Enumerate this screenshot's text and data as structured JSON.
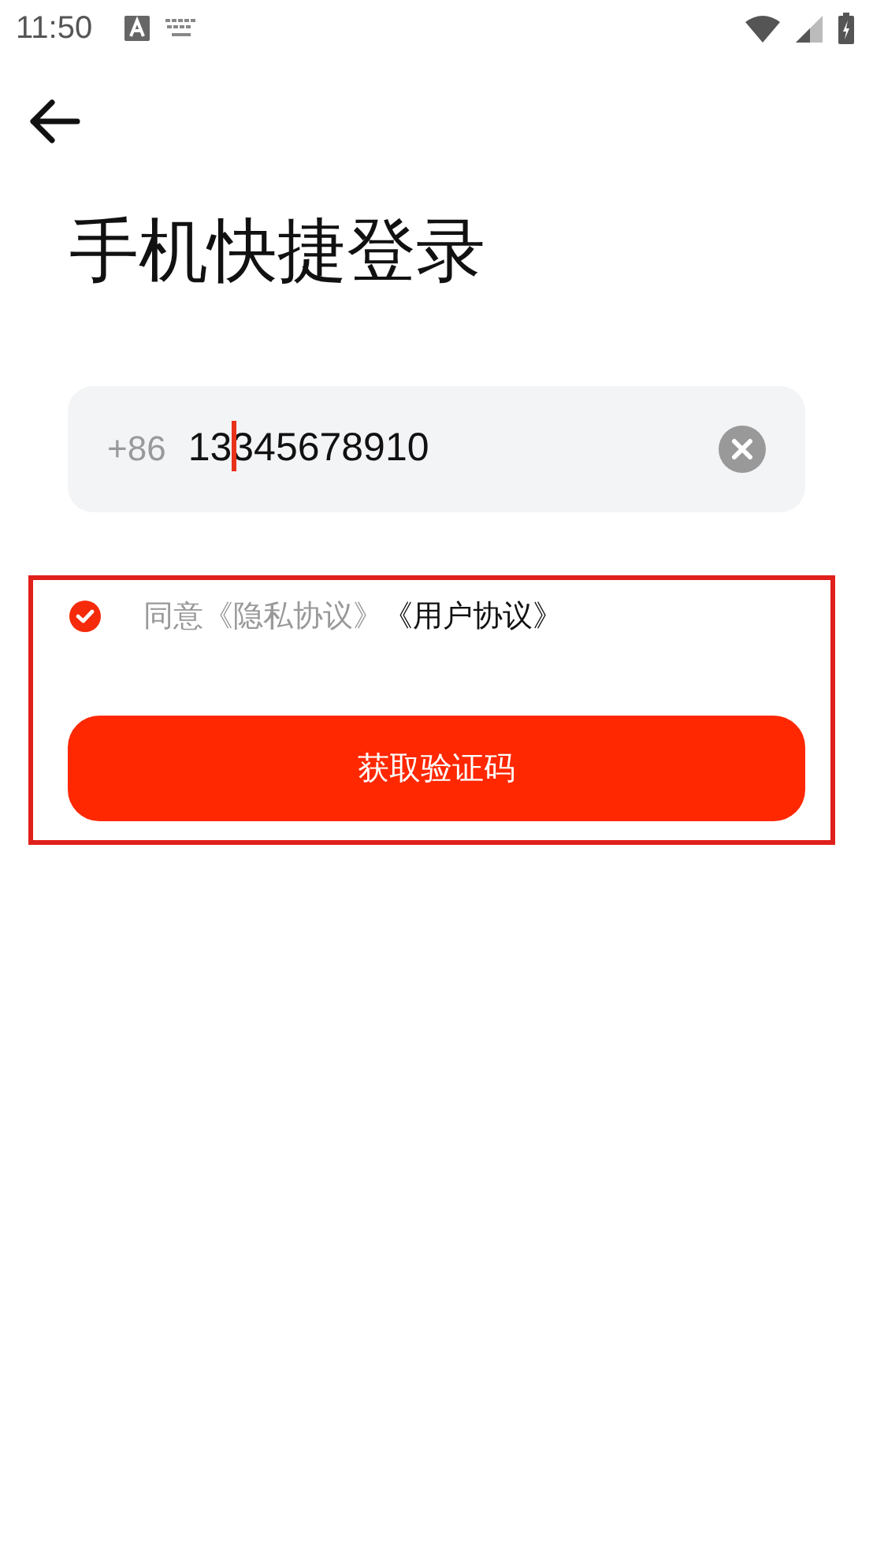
{
  "status_bar": {
    "time": "11:50"
  },
  "title": "手机快捷登录",
  "phone_field": {
    "prefix": "+86",
    "value": "13345678910",
    "focused": true
  },
  "agreement": {
    "checked": true,
    "text": "同意《隐私协议》",
    "link": "《用户协议》"
  },
  "submit_button": {
    "label": "获取验证码"
  },
  "highlight": {
    "shown": true
  }
}
